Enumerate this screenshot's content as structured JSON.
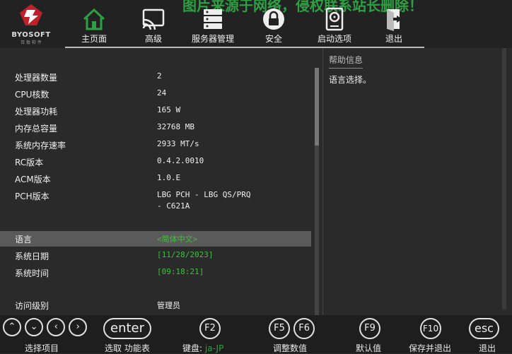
{
  "watermark": "图片来源于网络，侵权联系站长删除！",
  "logo": {
    "text": "BYOSOFT",
    "sub": "百 敖 软 件"
  },
  "menu": [
    {
      "label": "主页面",
      "icon": "home-icon"
    },
    {
      "label": "高级",
      "icon": "cast-icon"
    },
    {
      "label": "服务器管理",
      "icon": "server-icon"
    },
    {
      "label": "安全",
      "icon": "lock-icon"
    },
    {
      "label": "启动选项",
      "icon": "disk-icon"
    },
    {
      "label": "退出",
      "icon": "exit-icon"
    }
  ],
  "info": [
    {
      "label": "处理器数量",
      "value": "2"
    },
    {
      "label": "CPU核数",
      "value": "24"
    },
    {
      "label": "处理器功耗",
      "value": "165 W"
    },
    {
      "label": "内存总容量",
      "value": "32768 MB"
    },
    {
      "label": "系统内存速率",
      "value": "2933 MT/s"
    },
    {
      "label": "RC版本",
      "value": "0.4.2.0010"
    },
    {
      "label": "ACM版本",
      "value": "1.0.E"
    },
    {
      "label": "PCH版本",
      "value": "LBG PCH - LBG QS/PRQ",
      "value2": "- C621A"
    }
  ],
  "settings": {
    "language": {
      "label": "语言",
      "value": "<简体中文>"
    },
    "date": {
      "label": "系统日期",
      "value": "[11/28/2023]"
    },
    "time": {
      "label": "系统时间",
      "value": "[09:18:21]"
    },
    "access": {
      "label": "访问级别",
      "value": "管理员"
    }
  },
  "help": {
    "title": "帮助信息",
    "text": "语言选择。"
  },
  "keys": {
    "arrows_label": "选择项目",
    "enter": {
      "key": "enter",
      "label": "选取 功能表"
    },
    "f2": {
      "key": "F2",
      "label": "键盘:",
      "extra": "ja-JP"
    },
    "f5": {
      "key": "F5"
    },
    "f6": {
      "key": "F6",
      "label": "调整数值"
    },
    "f9": {
      "key": "F9",
      "label": "默认值"
    },
    "f10": {
      "key": "F10",
      "label": "保存并退出"
    },
    "esc": {
      "key": "esc",
      "label": "退出"
    }
  }
}
